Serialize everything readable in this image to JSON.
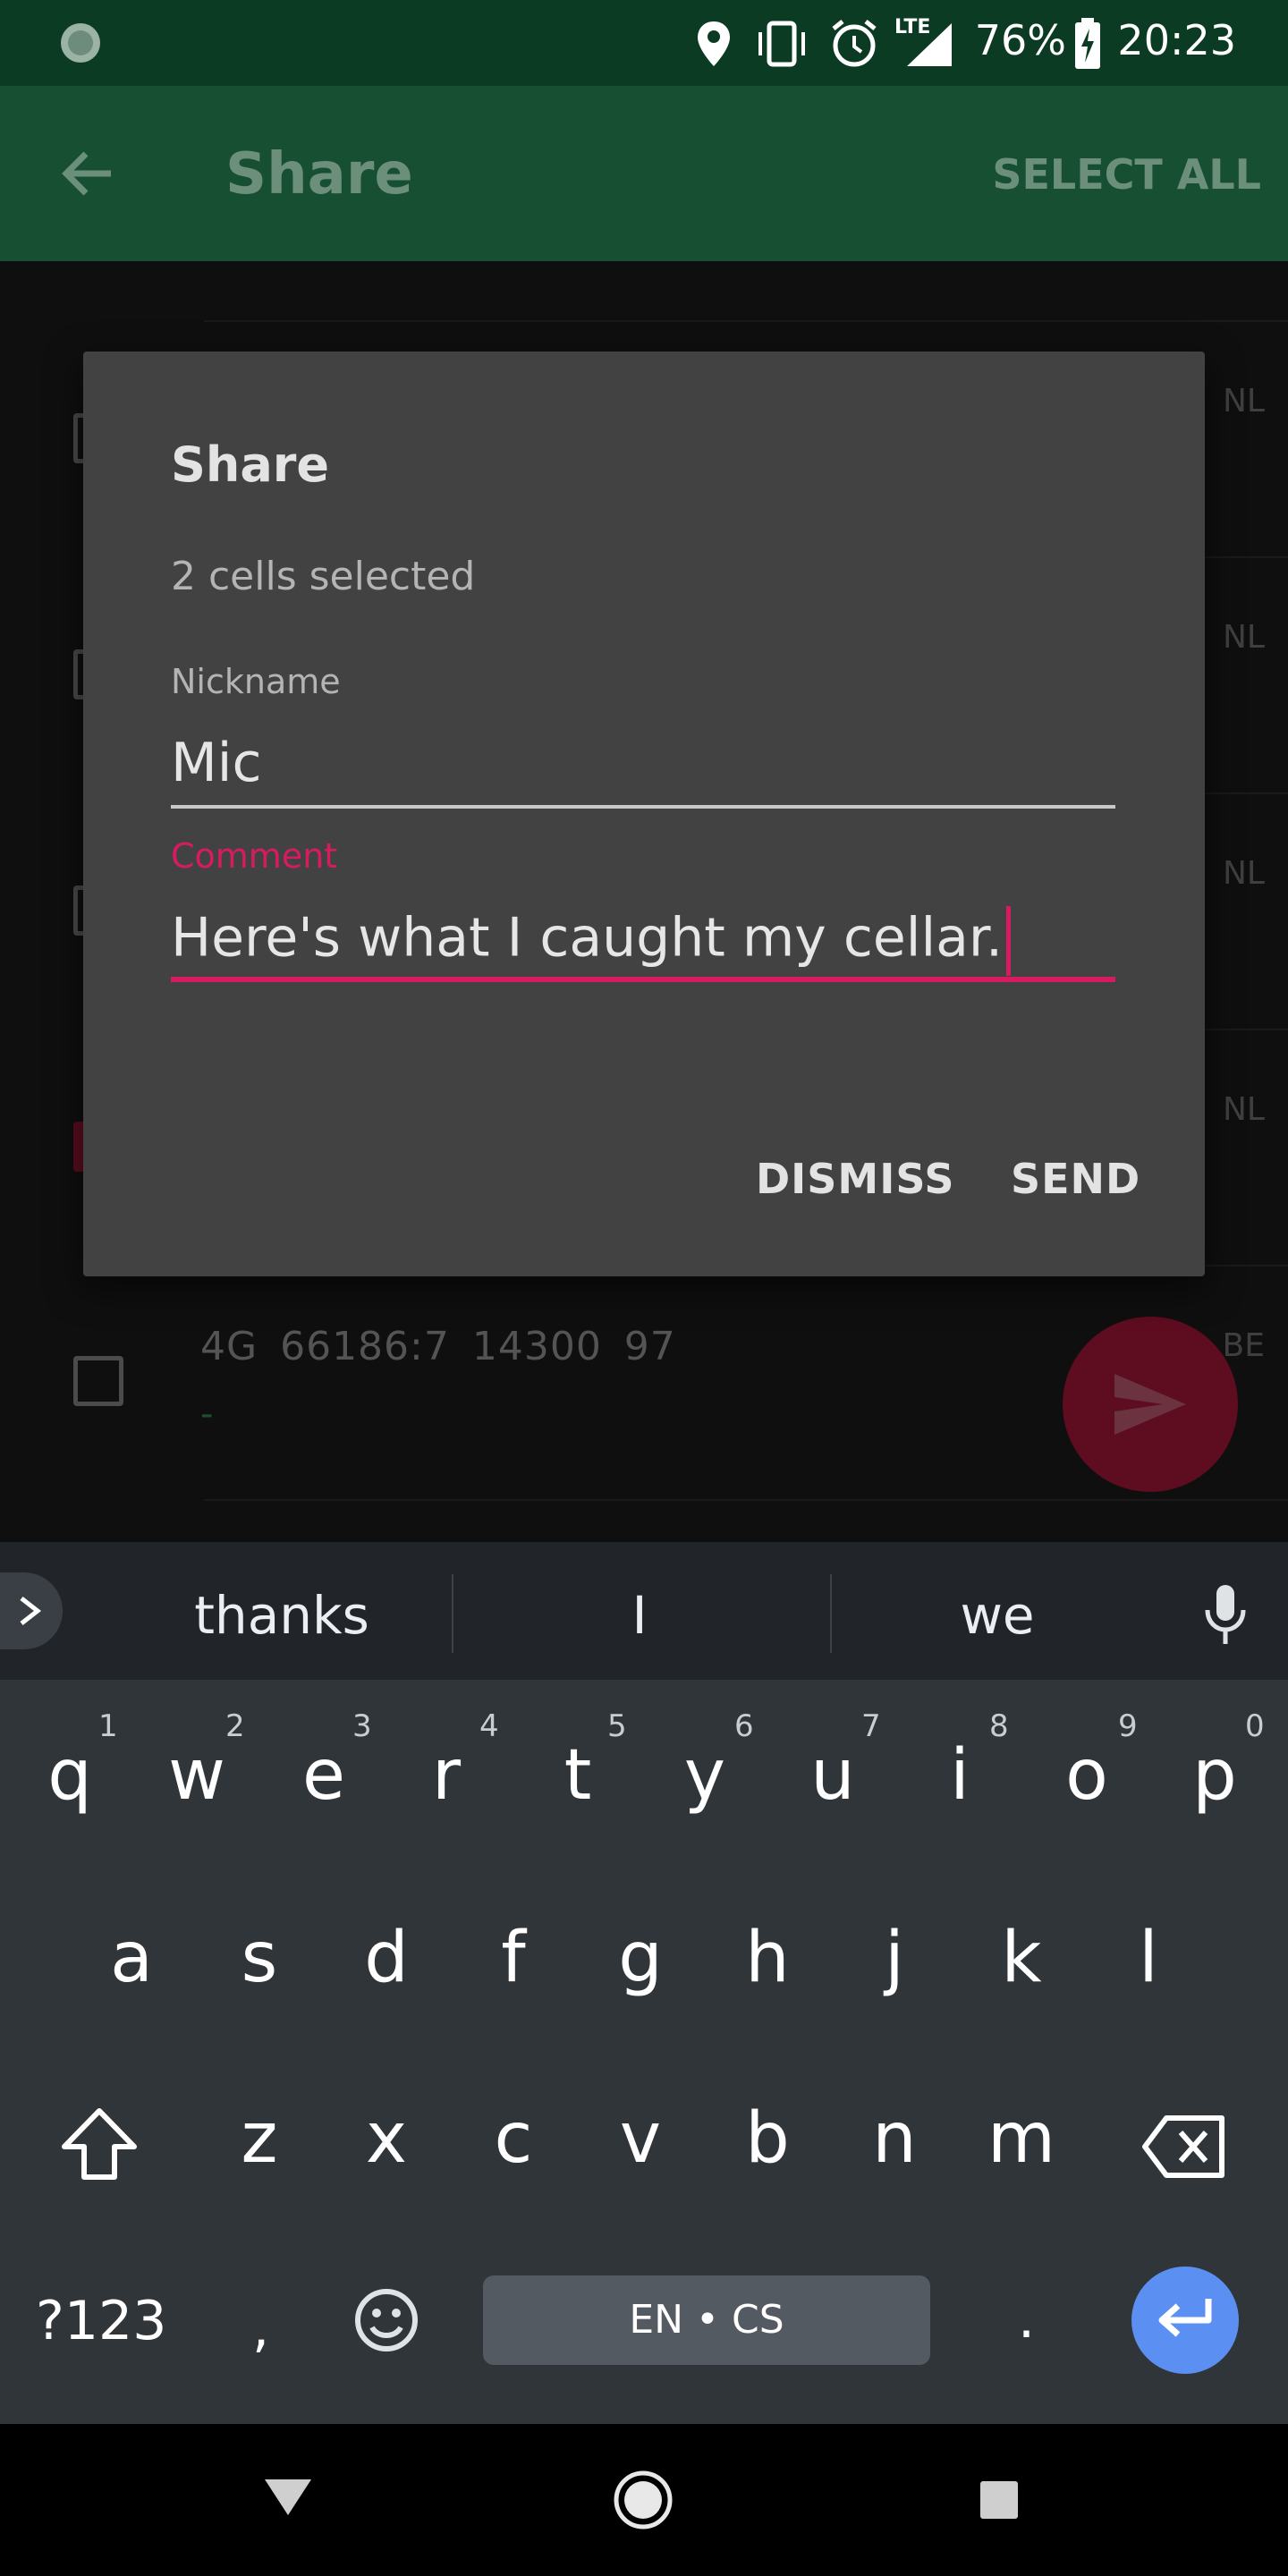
{
  "status_bar": {
    "battery_percent": "76%",
    "clock": "20:23",
    "network": "LTE"
  },
  "app_bar": {
    "title": "Share",
    "select_all": "SELECT ALL"
  },
  "list": {
    "rows": [
      {
        "tail": "NL"
      },
      {
        "tail": "NL"
      },
      {
        "tail": "NL"
      },
      {
        "tail": "NL"
      },
      {
        "text": "4G  66186:7  14300  97",
        "tail": "BE",
        "dash": "-"
      }
    ]
  },
  "dialog": {
    "title": "Share",
    "subtitle": "2 cells selected",
    "nickname_label": "Nickname",
    "nickname_value": "Mic",
    "comment_label": "Comment",
    "comment_value": "Here's what I caught my cellar.",
    "dismiss": "DISMISS",
    "send": "SEND"
  },
  "keyboard": {
    "suggestions": [
      "thanks",
      "I",
      "we"
    ],
    "row1": [
      "q",
      "w",
      "e",
      "r",
      "t",
      "y",
      "u",
      "i",
      "o",
      "p"
    ],
    "row1_hints": [
      "1",
      "2",
      "3",
      "4",
      "5",
      "6",
      "7",
      "8",
      "9",
      "0"
    ],
    "row2": [
      "a",
      "s",
      "d",
      "f",
      "g",
      "h",
      "j",
      "k",
      "l"
    ],
    "row3": [
      "z",
      "x",
      "c",
      "v",
      "b",
      "n",
      "m"
    ],
    "symbols_key": "?123",
    "comma_key": ",",
    "space_label": "EN • CS",
    "period_key": "."
  },
  "colors": {
    "accent": "#d81b60",
    "status_bar": "#0c3b24",
    "app_bar": "#174f33",
    "dialog_bg": "#424242",
    "enter_key": "#5b8ff2"
  }
}
